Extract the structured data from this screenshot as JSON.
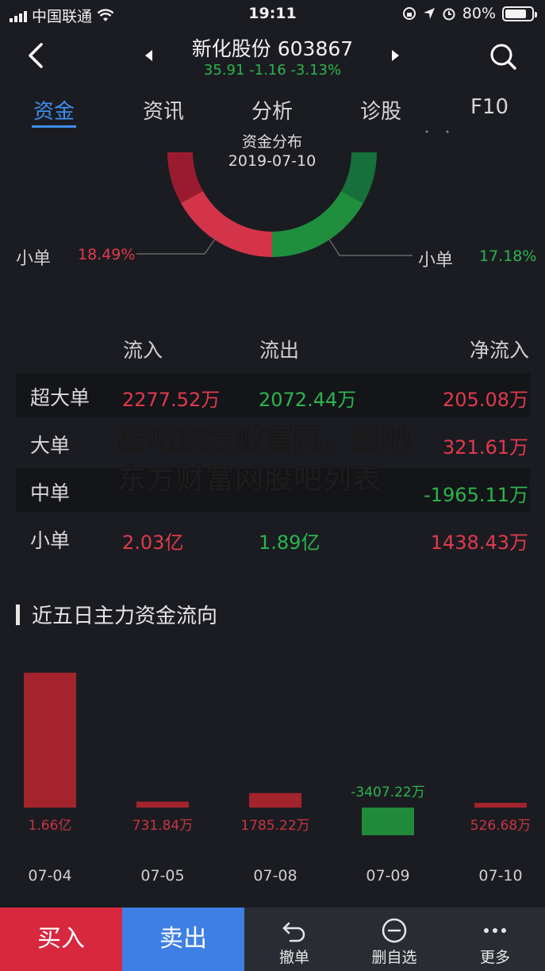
{
  "status_bar": {
    "carrier": "中国联通",
    "time": "19:11",
    "battery": "80%",
    "battery_level": 0.8
  },
  "header": {
    "title": "新化股份 603867",
    "subtitle": "35.91 -1.16 -3.13%"
  },
  "tabs": [
    {
      "label": "资金",
      "active": true
    },
    {
      "label": "资讯",
      "active": false
    },
    {
      "label": "分析",
      "active": false
    },
    {
      "label": "诊股",
      "active": false
    },
    {
      "label": "F10",
      "active": false
    }
  ],
  "donut": {
    "title": "资金分布",
    "date": "2019-07-10",
    "left_label": "小单",
    "left_pct": "18.49%",
    "right_label": "小单",
    "right_pct": "17.18%",
    "colors": {
      "dark_red": "#9b1b2e",
      "red": "#d4344a",
      "green": "#1f8f3e",
      "dark_green": "#16703a"
    }
  },
  "flow_table": {
    "headers": {
      "inflow": "流入",
      "outflow": "流出",
      "net": "净流入"
    },
    "rows": [
      {
        "label": "超大单",
        "inflow": "2277.52万",
        "outflow": "2072.44万",
        "net": "205.08万",
        "net_sign": "positive"
      },
      {
        "label": "大单",
        "inflow": "",
        "outflow": "",
        "net": "321.61万",
        "net_sign": "positive"
      },
      {
        "label": "中单",
        "inflow": "",
        "outflow": "",
        "net": "-1965.11万",
        "net_sign": "negative"
      },
      {
        "label": "小单",
        "inflow": "2.03亿",
        "outflow": "1.89亿",
        "net": "1438.43万",
        "net_sign": "positive"
      }
    ]
  },
  "watermark": "股吧东方财富网，股吧东方财富网股吧列表",
  "section": {
    "title": "近五日主力资金流向"
  },
  "chart_data": {
    "type": "bar",
    "categories": [
      "07-04",
      "07-05",
      "07-08",
      "07-09",
      "07-10"
    ],
    "values": [
      16600,
      731.84,
      1785.22,
      -3407.22,
      526.68
    ],
    "value_labels": [
      "1.66亿",
      "731.84万",
      "1785.22万",
      "-3407.22万",
      "526.68万"
    ],
    "unit": "万",
    "colors": {
      "positive": "#a3242c",
      "negative": "#1f8a3a"
    }
  },
  "bottom_bar": {
    "buy": "买入",
    "sell": "卖出",
    "tools": [
      {
        "label": "撤单",
        "icon": "undo-icon"
      },
      {
        "label": "删自选",
        "icon": "remove-favorite-icon"
      },
      {
        "label": "更多",
        "icon": "more-icon"
      }
    ]
  }
}
